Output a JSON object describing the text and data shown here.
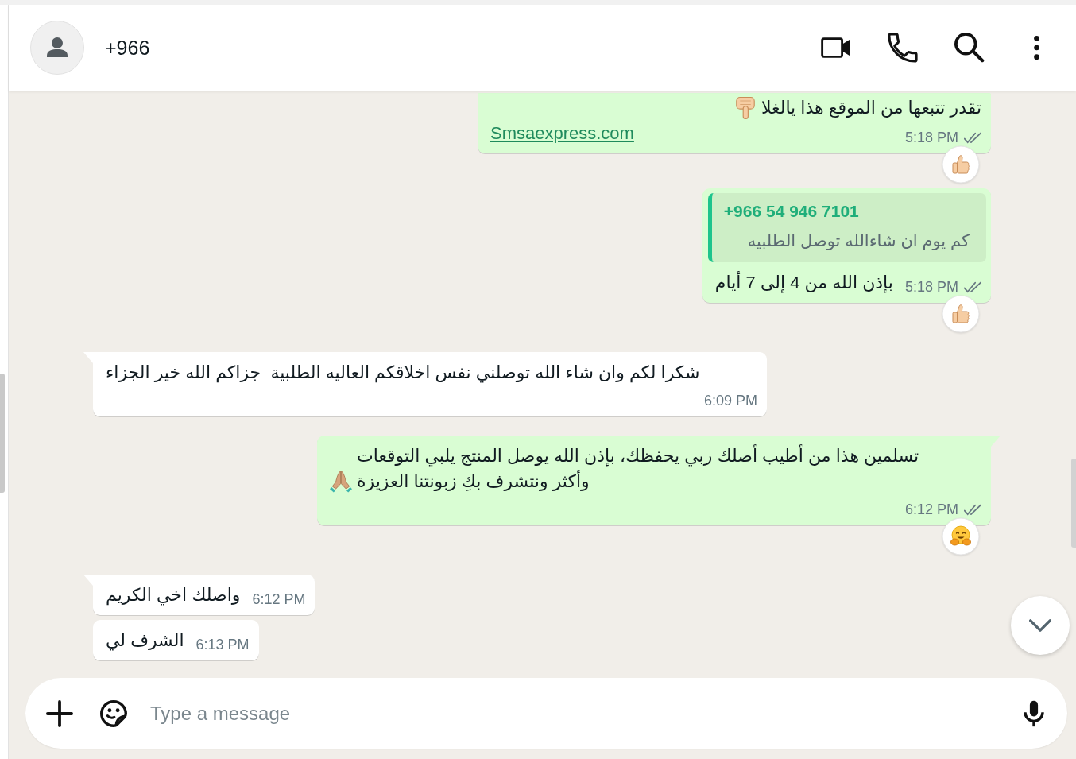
{
  "header": {
    "contact_name": "+966"
  },
  "messages": [
    {
      "kind": "outgoing",
      "text": "تقدر تتبعها من الموقع هذا يالغلا",
      "emoji": {
        "kind": "pointing-down"
      },
      "link": "Smsaexpress.com",
      "time": "5:18 PM",
      "read": false,
      "reaction": {
        "kind": "thumbs-up"
      }
    },
    {
      "kind": "outgoing",
      "quote": {
        "author": "+966 54 946 7101",
        "text": "كم يوم ان شاءالله توصل الطلبيه"
      },
      "text": "بإذن الله من 4 إلى 7 أيام",
      "time": "5:18 PM",
      "read": false,
      "reaction": {
        "kind": "thumbs-up"
      }
    },
    {
      "kind": "incoming",
      "text": "شكرا لكم وان شاء الله توصلني نفس اخلاقكم العاليه الطلبية  جزاكم الله خير الجزاء",
      "time": "6:09 PM"
    },
    {
      "kind": "outgoing",
      "text": "تسلمين هذا من أطيب أصلك ربي يحفظك، بإذن الله يوصل المنتج يلبي التوقعات\nوأكثر ونتشرف بكِ زبونتنا العزيزة",
      "emoji": {
        "kind": "praying-hands"
      },
      "time": "6:12 PM",
      "read": false,
      "reaction": {
        "kind": "hugging-face"
      }
    },
    {
      "kind": "incoming",
      "text": "واصلك اخي الكريم",
      "time": "6:12 PM"
    },
    {
      "kind": "incoming",
      "text": "الشرف لي",
      "time": "6:13 PM"
    }
  ],
  "composer": {
    "placeholder": "Type a message"
  }
}
